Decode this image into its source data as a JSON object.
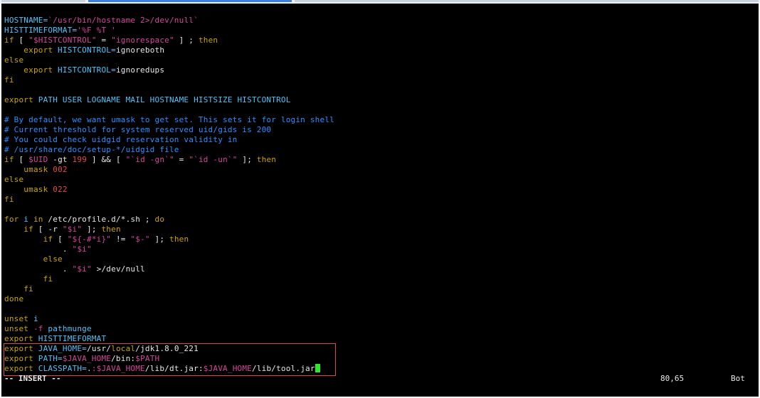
{
  "lines": [
    [
      [
        "v",
        "HOSTNAME="
      ],
      [
        "s",
        "`/usr/bin/hostname 2>/dev/null`"
      ]
    ],
    [
      [
        "v",
        "HISTTIMEFORMAT="
      ],
      [
        "s",
        "'%F %T '"
      ]
    ],
    [
      [
        "k",
        "if"
      ],
      [
        "d",
        " [ "
      ],
      [
        "s",
        "\"$HISTCONTROL\""
      ],
      [
        "d",
        " = "
      ],
      [
        "s",
        "\"ignorespace\""
      ],
      [
        "d",
        " ] ; "
      ],
      [
        "k",
        "then"
      ]
    ],
    [
      [
        "d",
        "    "
      ],
      [
        "k",
        "export"
      ],
      [
        "v",
        " HISTCONTROL="
      ],
      [
        "d",
        "ignoreboth"
      ]
    ],
    [
      [
        "k",
        "else"
      ]
    ],
    [
      [
        "d",
        "    "
      ],
      [
        "k",
        "export"
      ],
      [
        "v",
        " HISTCONTROL="
      ],
      [
        "d",
        "ignoredups"
      ]
    ],
    [
      [
        "k",
        "fi"
      ]
    ],
    [
      [
        "d",
        ""
      ]
    ],
    [
      [
        "k",
        "export"
      ],
      [
        "v",
        " PATH USER LOGNAME MAIL HOSTNAME HISTSIZE HISTCONTROL"
      ]
    ],
    [
      [
        "d",
        ""
      ]
    ],
    [
      [
        "c",
        "# By default, we want umask to get set. This sets it for login shell"
      ]
    ],
    [
      [
        "c",
        "# Current threshold for system reserved uid/gids is 200"
      ]
    ],
    [
      [
        "c",
        "# You could check uidgid reservation validity in"
      ]
    ],
    [
      [
        "c",
        "# /usr/share/doc/setup-*/uidgid file"
      ]
    ],
    [
      [
        "k",
        "if"
      ],
      [
        "d",
        " [ "
      ],
      [
        "s",
        "$UID"
      ],
      [
        "d",
        " -gt "
      ],
      [
        "n",
        "199"
      ],
      [
        "d",
        " ] && [ "
      ],
      [
        "s",
        "\"`id -gn`\""
      ],
      [
        "d",
        " = "
      ],
      [
        "s",
        "\"`id -un`\""
      ],
      [
        "d",
        " ]; "
      ],
      [
        "k",
        "then"
      ]
    ],
    [
      [
        "d",
        "    "
      ],
      [
        "k",
        "umask"
      ],
      [
        "n",
        " 002"
      ]
    ],
    [
      [
        "k",
        "else"
      ]
    ],
    [
      [
        "d",
        "    "
      ],
      [
        "k",
        "umask"
      ],
      [
        "n",
        " 022"
      ]
    ],
    [
      [
        "k",
        "fi"
      ]
    ],
    [
      [
        "d",
        ""
      ]
    ],
    [
      [
        "k",
        "for"
      ],
      [
        "v",
        " i "
      ],
      [
        "k",
        "in"
      ],
      [
        "d",
        " /etc/profile.d/*.sh ; "
      ],
      [
        "k",
        "do"
      ]
    ],
    [
      [
        "d",
        "    "
      ],
      [
        "k",
        "if"
      ],
      [
        "d",
        " [ -r "
      ],
      [
        "s",
        "\"$i\""
      ],
      [
        "d",
        " ]; "
      ],
      [
        "k",
        "then"
      ]
    ],
    [
      [
        "d",
        "        "
      ],
      [
        "k",
        "if"
      ],
      [
        "d",
        " [ "
      ],
      [
        "s",
        "\"${-#*i}\""
      ],
      [
        "d",
        " != "
      ],
      [
        "s",
        "\"$-\""
      ],
      [
        "d",
        " ]; "
      ],
      [
        "k",
        "then"
      ]
    ],
    [
      [
        "d",
        "            . "
      ],
      [
        "s",
        "\"$i\""
      ]
    ],
    [
      [
        "d",
        "        "
      ],
      [
        "k",
        "else"
      ]
    ],
    [
      [
        "d",
        "            . "
      ],
      [
        "s",
        "\"$i\""
      ],
      [
        "d",
        " >/dev/null"
      ]
    ],
    [
      [
        "d",
        "        "
      ],
      [
        "k",
        "fi"
      ]
    ],
    [
      [
        "d",
        "    "
      ],
      [
        "k",
        "fi"
      ]
    ],
    [
      [
        "k",
        "done"
      ]
    ],
    [
      [
        "d",
        ""
      ]
    ],
    [
      [
        "k",
        "unset"
      ],
      [
        "v",
        " i"
      ]
    ],
    [
      [
        "k",
        "unset"
      ],
      [
        "s",
        " -f"
      ],
      [
        "v",
        " pathmunge"
      ]
    ],
    [
      [
        "k",
        "export"
      ],
      [
        "v",
        " HISTTIMEFORMAT"
      ]
    ],
    [
      [
        "k",
        "export"
      ],
      [
        "v",
        " JAVA_HOME="
      ],
      [
        "d",
        "/usr/"
      ],
      [
        "k",
        "local"
      ],
      [
        "d",
        "/jdk1.8.0_221"
      ]
    ],
    [
      [
        "k",
        "export"
      ],
      [
        "v",
        " PATH="
      ],
      [
        "s",
        "$JAVA_HOME"
      ],
      [
        "d",
        "/bin:"
      ],
      [
        "s",
        "$PATH"
      ]
    ],
    [
      [
        "k",
        "export"
      ],
      [
        "v",
        " CLASSPATH="
      ],
      [
        "d",
        "."
      ],
      [
        "s",
        ":$JAVA_HOME"
      ],
      [
        "d",
        "/lib/dt.jar:"
      ],
      [
        "s",
        "$JAVA_HOME"
      ],
      [
        "d",
        "/lib/tool.jar"
      ]
    ]
  ],
  "status": {
    "mode": "-- INSERT --",
    "position": "80,65",
    "scroll": "Bot"
  },
  "colors": {
    "background": "#000000",
    "keyword": "#c8a400",
    "string": "#d2479a",
    "comment": "#2a8fff",
    "highlight_box": "#e04848",
    "cursor": "#2ee82e"
  }
}
